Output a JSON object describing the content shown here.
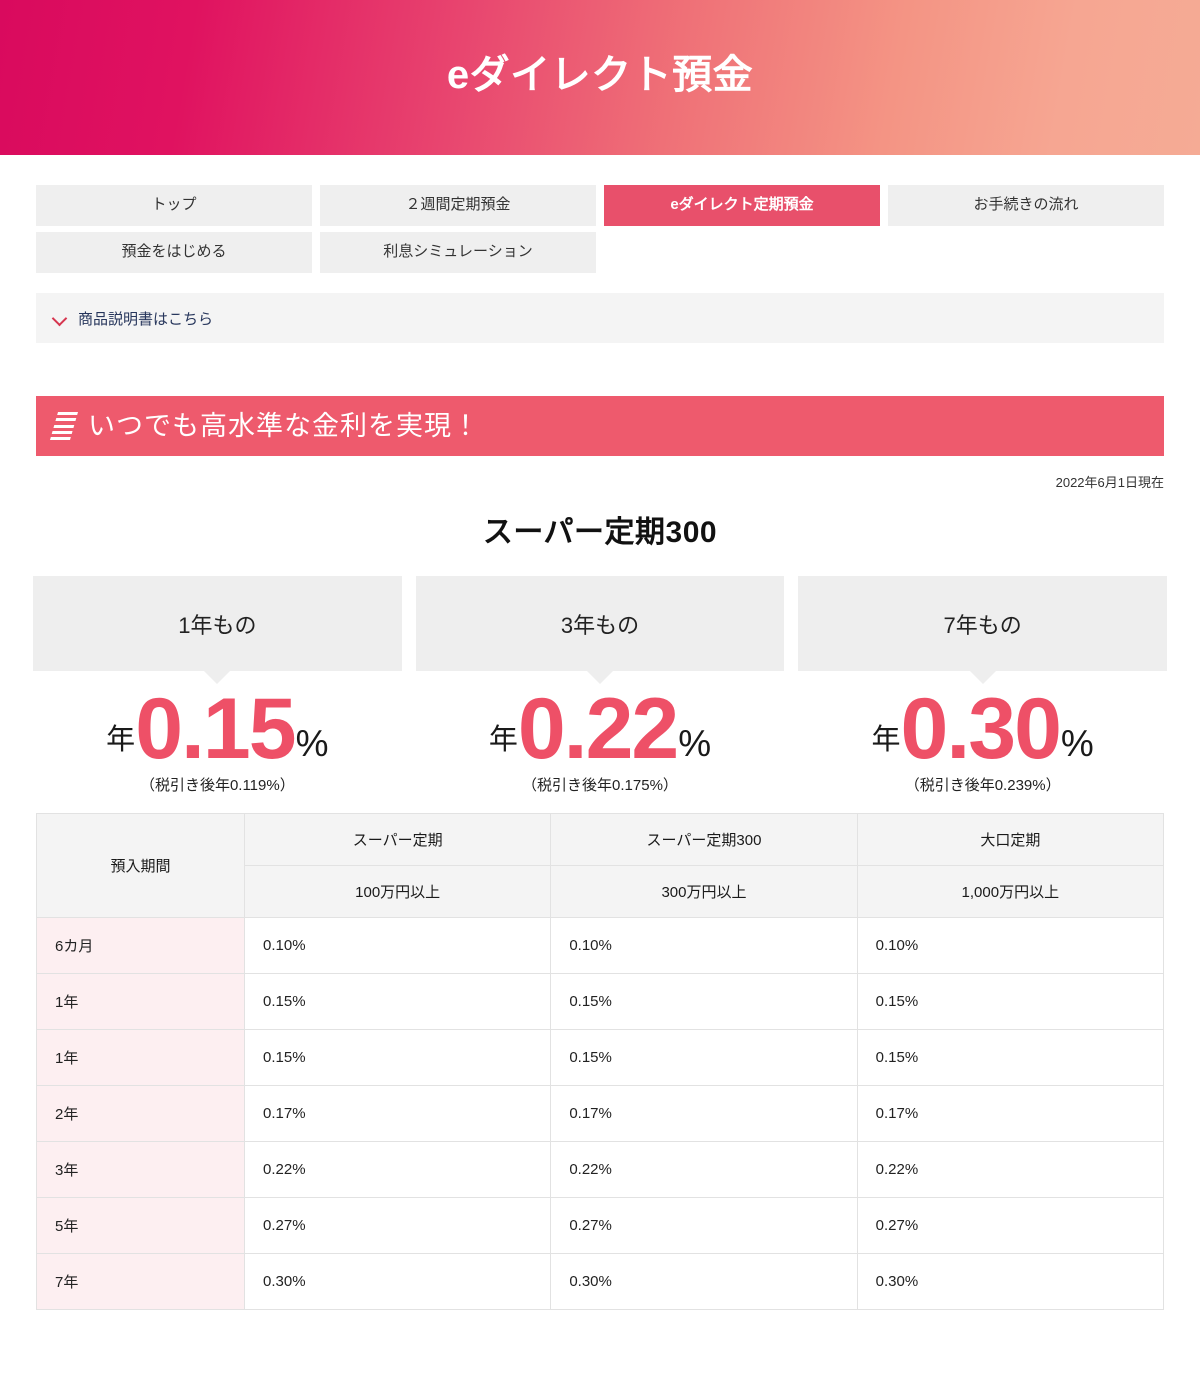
{
  "hero": {
    "title": "eダイレクト預金"
  },
  "nav": {
    "tabs": [
      {
        "label": "トップ",
        "active": false
      },
      {
        "label": "２週間定期預金",
        "active": false
      },
      {
        "label": "eダイレクト定期預金",
        "active": true
      },
      {
        "label": "お手続きの流れ",
        "active": false
      },
      {
        "label": "預金をはじめる",
        "active": false
      },
      {
        "label": "利息シミュレーション",
        "active": false
      }
    ]
  },
  "disclosure": {
    "label": "商品説明書はこちら",
    "icon": "chevron-down-icon"
  },
  "banner": {
    "title": "いつでも高水準な金利を実現！",
    "icon": "slanted-lines-icon",
    "color": "#ee5a6d"
  },
  "section": {
    "as_of": "2022年6月1日現在",
    "product_title": "スーパー定期300"
  },
  "cards": [
    {
      "term": "1年もの",
      "prefix": "年",
      "rate": "0.15",
      "suffix": "%",
      "note": "（税引き後年0.119%）"
    },
    {
      "term": "3年もの",
      "prefix": "年",
      "rate": "0.22",
      "suffix": "%",
      "note": "（税引き後年0.175%）"
    },
    {
      "term": "7年もの",
      "prefix": "年",
      "rate": "0.30",
      "suffix": "%",
      "note": "（税引き後年0.239%）"
    }
  ],
  "table": {
    "period_header": "預入期間",
    "group_headers": [
      "スーパー定期",
      "スーパー定期300",
      "大口定期"
    ],
    "amount_headers": [
      "100万円以上",
      "300万円以上",
      "1,000万円以上"
    ],
    "rows": [
      {
        "period": "6カ月",
        "values": [
          "0.10%",
          "0.10%",
          "0.10%"
        ]
      },
      {
        "period": "1年",
        "values": [
          "0.15%",
          "0.15%",
          "0.15%"
        ]
      },
      {
        "period": "1年",
        "values": [
          "0.15%",
          "0.15%",
          "0.15%"
        ]
      },
      {
        "period": "2年",
        "values": [
          "0.17%",
          "0.17%",
          "0.17%"
        ]
      },
      {
        "period": "3年",
        "values": [
          "0.22%",
          "0.22%",
          "0.22%"
        ]
      },
      {
        "period": "5年",
        "values": [
          "0.27%",
          "0.27%",
          "0.27%"
        ]
      },
      {
        "period": "7年",
        "values": [
          "0.30%",
          "0.30%",
          "0.30%"
        ]
      }
    ]
  },
  "colors": {
    "brand_magenta": "#d90a5e",
    "brand_salmon": "#f5ab95",
    "accent_pink": "#ee5a6d",
    "rate_pink": "#ee5067",
    "link_navy": "#27365c",
    "row_tint": "#fdeff1"
  }
}
